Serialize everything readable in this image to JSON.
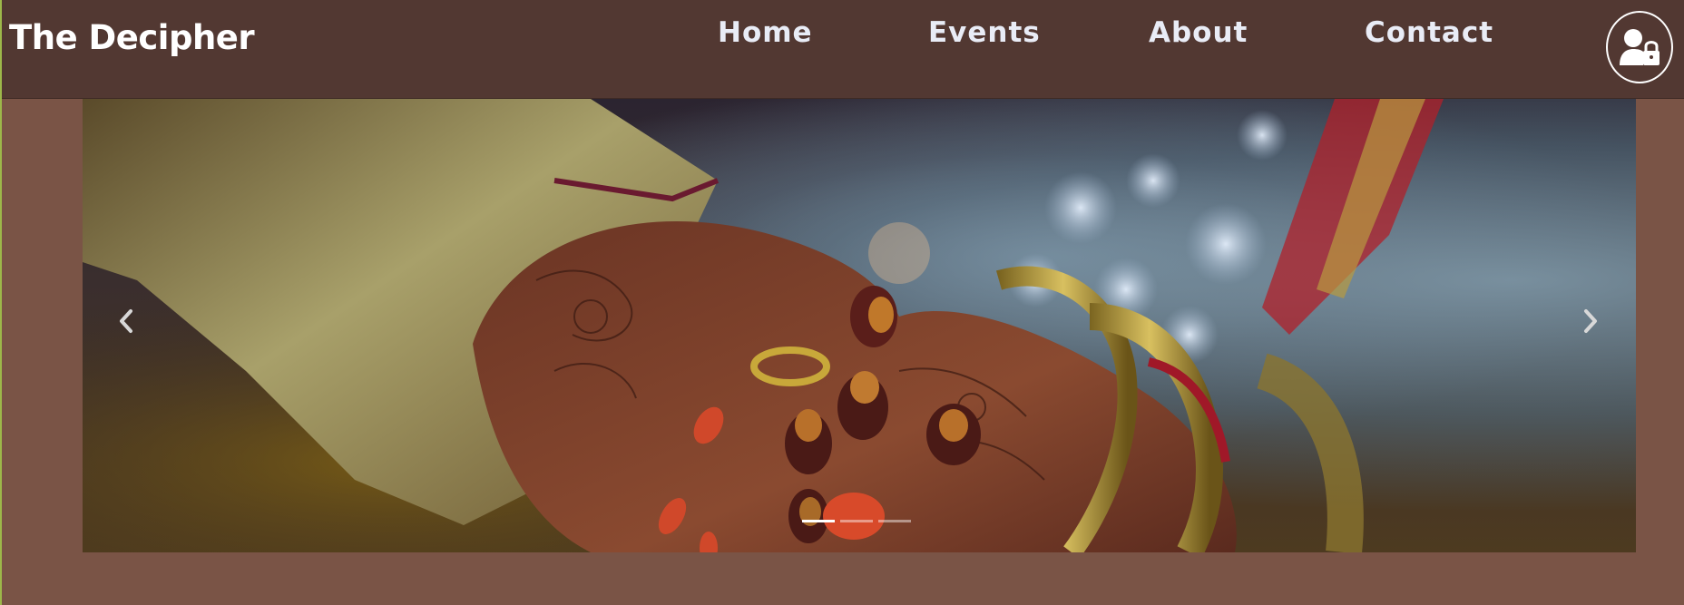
{
  "navbar": {
    "brand": "The Decipher",
    "links": [
      {
        "label": "Home"
      },
      {
        "label": "Events"
      },
      {
        "label": "About"
      },
      {
        "label": "Contact"
      }
    ],
    "login_icon": "user-lock-icon"
  },
  "carousel": {
    "image": "wedding-hands-henna",
    "prev_icon": "chevron-left-icon",
    "next_icon": "chevron-right-icon",
    "slide_count": 3,
    "active_slide": 1
  },
  "colors": {
    "navbar_bg": "#523832",
    "page_bg": "#7a5446",
    "nav_text": "#e9ecf6"
  }
}
